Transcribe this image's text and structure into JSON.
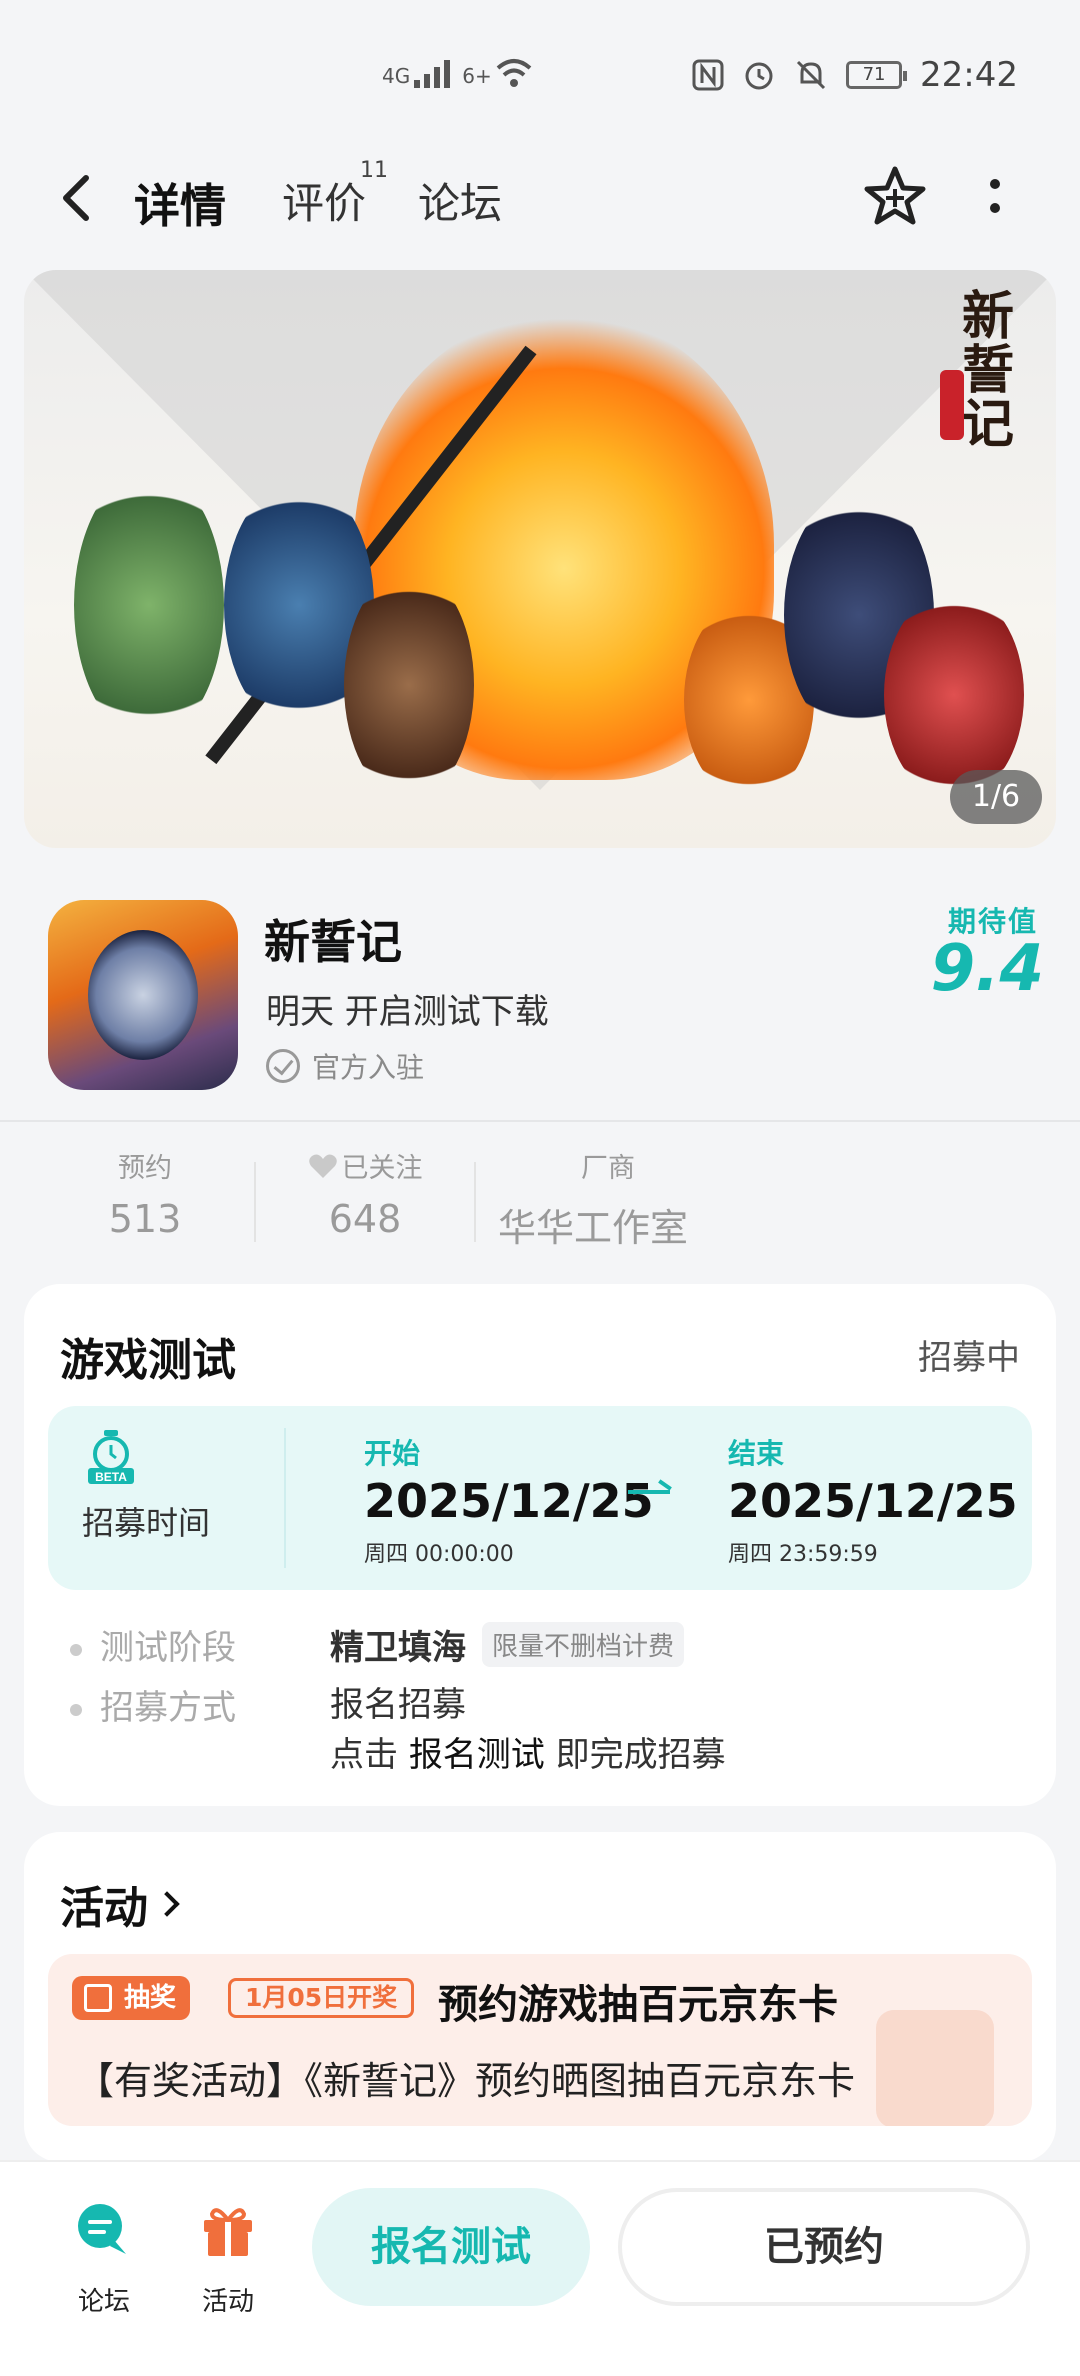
{
  "status_bar": {
    "network": "4G",
    "wifi": "6+",
    "battery": "71",
    "time": "22:42",
    "icons": [
      "nfc-icon",
      "alarm-icon",
      "mute-icon"
    ]
  },
  "nav": {
    "tabs": [
      {
        "label": "详情",
        "active": true
      },
      {
        "label": "评价",
        "badge": "11"
      },
      {
        "label": "论坛"
      }
    ]
  },
  "banner": {
    "logo_text": "新誓记",
    "pager": "1/6"
  },
  "game": {
    "name": "新誓记",
    "subtitle": "明天 开启测试下载",
    "official": "官方入驻",
    "expect_label": "期待值",
    "expect_value": "9.4"
  },
  "stats": [
    {
      "label": "预约",
      "value": "513"
    },
    {
      "label": "已关注",
      "value": "648"
    },
    {
      "label": "厂商",
      "value": "华华工作室"
    }
  ],
  "test_card": {
    "title": "游戏测试",
    "status": "招募中",
    "recruit_label": "招募时间",
    "beta_text": "BETA",
    "start": {
      "label": "开始",
      "date": "2025/12/25",
      "week_time": "周四  00:00:00"
    },
    "end": {
      "label": "结束",
      "date": "2025/12/25",
      "week_time": "周四  23:59:59"
    },
    "rows": [
      {
        "key": "测试阶段",
        "value": "精卫填海",
        "tag": "限量不删档计费"
      },
      {
        "key": "招募方式",
        "value": "报名招募",
        "note_pre": "点击 ",
        "note_em": "报名测试",
        "note_post": " 即完成招募"
      }
    ]
  },
  "activity_card": {
    "title": "活动",
    "badge": "抽奖",
    "date_badge": "1月05日开奖",
    "headline": "预约游戏抽百元京东卡",
    "desc": "【有奖活动】《新誓记》预约晒图抽百元京东卡"
  },
  "bottom_bar": {
    "forum": "论坛",
    "activity": "活动",
    "signup": "报名测试",
    "booked": "已预约"
  },
  "colors": {
    "accent": "#16b8b0",
    "orange": "#f06f3c"
  }
}
